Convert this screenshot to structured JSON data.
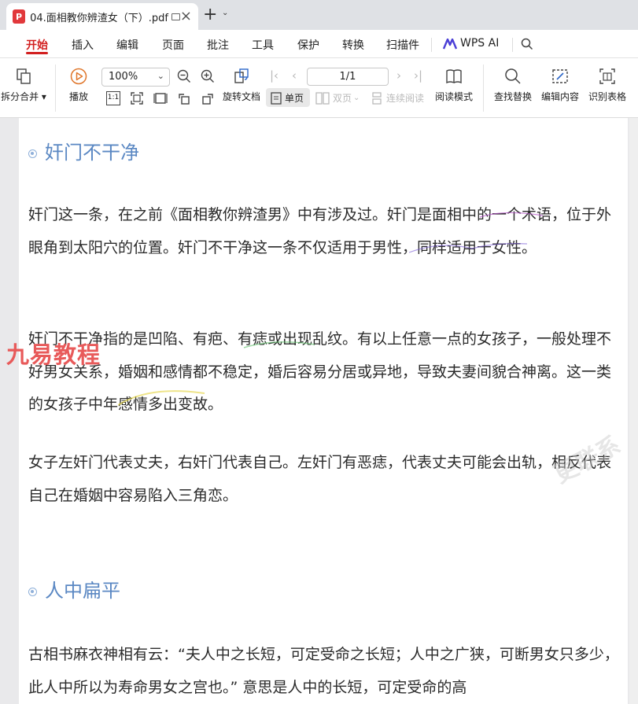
{
  "tab": {
    "title": "04.面相教你辨渣女（下）.pdf",
    "pdf_icon": "P"
  },
  "menu": {
    "items": [
      "开始",
      "插入",
      "编辑",
      "页面",
      "批注",
      "工具",
      "保护",
      "转换",
      "扫描件"
    ],
    "ai_label": "WPS AI"
  },
  "toolbar": {
    "split_merge": "拆分合并",
    "play": "播放",
    "zoom": "100%",
    "rotate": "旋转文档",
    "page_value": "1/1",
    "single_page": "单页",
    "double_page": "双页",
    "continuous": "连续阅读",
    "read_mode": "阅读模式",
    "find_replace": "查找替换",
    "edit_content": "编辑内容",
    "recognize_table": "识别表格"
  },
  "document": {
    "heading1": "奸门不干净",
    "p1": "奸门这一条，在之前《面相教你辨渣男》中有涉及过。奸门是面相中的一个术语，位于外眼角到太阳穴的位置。奸门不干净这一条不仅适用于男性，同样适用于女性。",
    "p2": "奸门不干净指的是凹陷、有疤、有痣或出现乱纹。有以上任意一点的女孩子，一般处理不好男女关系，婚姻和感情都不稳定，婚后容易分居或异地，导致夫妻间貌合神离。这一类的女孩子中年感情多出变故。",
    "p3": "女子左奸门代表丈夫，右奸门代表自己。左奸门有恶痣，代表丈夫可能会出轨，相反代表自己在婚姻中容易陷入三角恋。",
    "heading2": "人中扁平",
    "p4": "古相书麻衣神相有云：“夫人中之长短，可定受命之长短；人中之广狭，可断男女只多少，此人中所以为寿命男女之宫也。” 意思是人中的长短，可定受命的高"
  },
  "watermark": {
    "text": "九易教程",
    "faint_text": "更联系"
  },
  "colors": {
    "accent": "#d21f1f",
    "heading": "#5b88c3",
    "watermark": "#e85a5a"
  }
}
